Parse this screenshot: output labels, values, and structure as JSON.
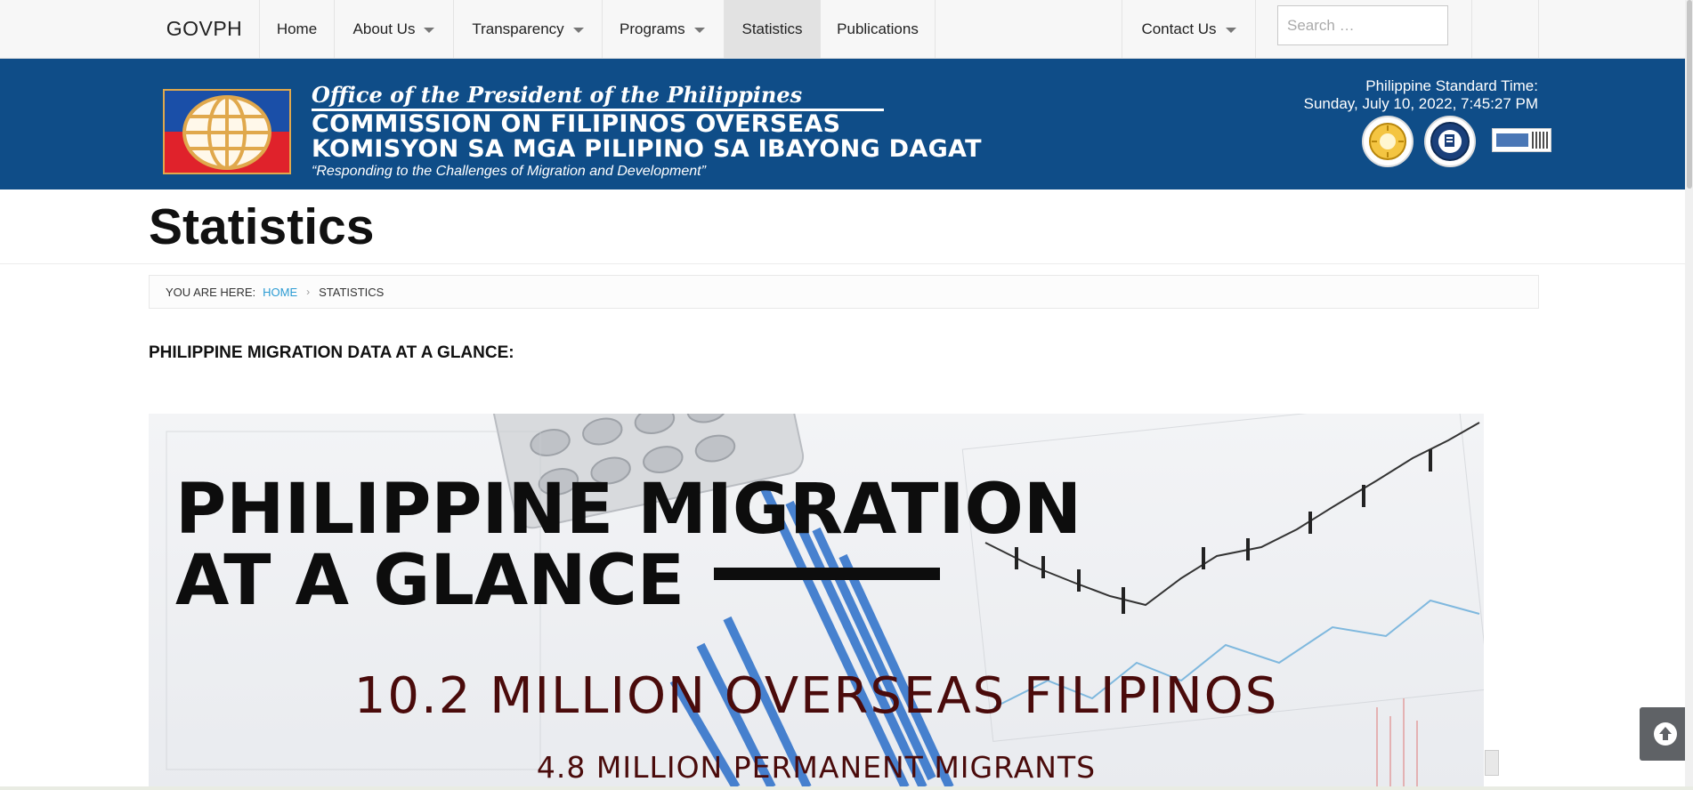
{
  "nav": {
    "brand": "GOVPH",
    "items": [
      {
        "label": "Home",
        "dropdown": false,
        "active": false
      },
      {
        "label": "About Us",
        "dropdown": true,
        "active": false
      },
      {
        "label": "Transparency",
        "dropdown": true,
        "active": false
      },
      {
        "label": "Programs",
        "dropdown": true,
        "active": false
      },
      {
        "label": "Statistics",
        "dropdown": false,
        "active": true
      },
      {
        "label": "Publications",
        "dropdown": false,
        "active": false
      },
      {
        "label": "Contact Us",
        "dropdown": true,
        "active": false
      }
    ],
    "search": {
      "placeholder": "Search …",
      "value": ""
    }
  },
  "banner": {
    "office": "Office of the President of the Philippines",
    "name_en": "COMMISSION ON FILIPINOS OVERSEAS",
    "name_tl": "KOMISYON SA MGA PILIPINO SA IBAYONG DAGAT",
    "tagline": "“Responding to the Challenges of Migration and Development”",
    "pst_label": "Philippine Standard Time:",
    "pst_time": "Sunday, July 10, 2022, 7:45:27 PM",
    "badges": [
      "transparency-seal-icon",
      "freedom-of-information-seal-icon",
      "iso-certification-icon"
    ],
    "colors": {
      "banner": "#0f4d88",
      "flag_blue": "#1a4fa8",
      "flag_red": "#e0222b",
      "globe": "#e0a84c"
    }
  },
  "page": {
    "title": "Statistics",
    "breadcrumb": {
      "prefix": "YOU ARE HERE:",
      "home": "HOME",
      "current": "STATISTICS"
    },
    "section_heading": "PHILIPPINE MIGRATION DATA AT A GLANCE:"
  },
  "hero": {
    "title_line1": "PHILIPPINE MIGRATION",
    "title_line2": "AT A GLANCE",
    "stat1": "10.2 MILLION OVERSEAS FILIPINOS",
    "stat2": "4.8 MILLION PERMANENT MIGRANTS",
    "text_color": "#4a0b0b"
  },
  "controls": {
    "scroll_top_icon": "arrow-up-circle-icon"
  }
}
